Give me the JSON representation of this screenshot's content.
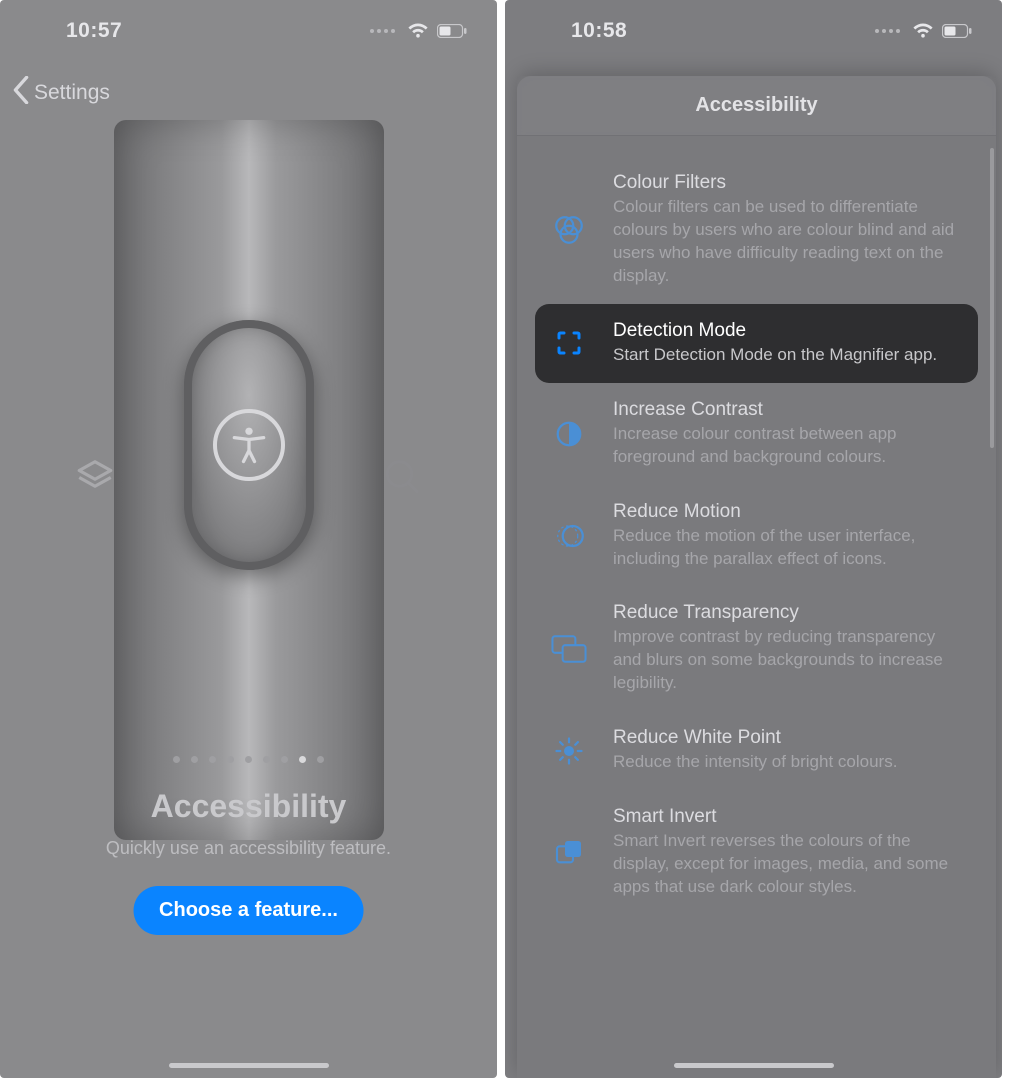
{
  "left": {
    "status_time": "10:57",
    "back_label": "Settings",
    "hero_title": "Accessibility",
    "hero_sub": "Quickly use an accessibility feature.",
    "cta_label": "Choose a feature...",
    "page_dots_total": 9,
    "page_dots_active_index": 7
  },
  "right": {
    "status_time": "10:58",
    "sheet_title": "Accessibility",
    "rows": [
      {
        "icon": "colour-filters-icon",
        "title": "Colour Filters",
        "desc": "Colour filters can be used to differentiate colours by users who are colour blind and aid users who have difficulty reading text on the display.",
        "highlight": false
      },
      {
        "icon": "detection-mode-icon",
        "title": "Detection Mode",
        "desc": "Start Detection Mode on the Magnifier app.",
        "highlight": true
      },
      {
        "icon": "increase-contrast-icon",
        "title": "Increase Contrast",
        "desc": "Increase colour contrast between app foreground and background colours.",
        "highlight": false
      },
      {
        "icon": "reduce-motion-icon",
        "title": "Reduce Motion",
        "desc": "Reduce the motion of the user interface, including the parallax effect of icons.",
        "highlight": false
      },
      {
        "icon": "reduce-transparency-icon",
        "title": "Reduce Transparency",
        "desc": "Improve contrast by reducing transparency and blurs on some backgrounds to increase legibility.",
        "highlight": false
      },
      {
        "icon": "reduce-white-point-icon",
        "title": "Reduce White Point",
        "desc": "Reduce the intensity of bright colours.",
        "highlight": false
      },
      {
        "icon": "smart-invert-icon",
        "title": "Smart Invert",
        "desc": "Smart Invert reverses the colours of the display, except for images, media, and some apps that use dark colour styles.",
        "highlight": false
      }
    ]
  }
}
